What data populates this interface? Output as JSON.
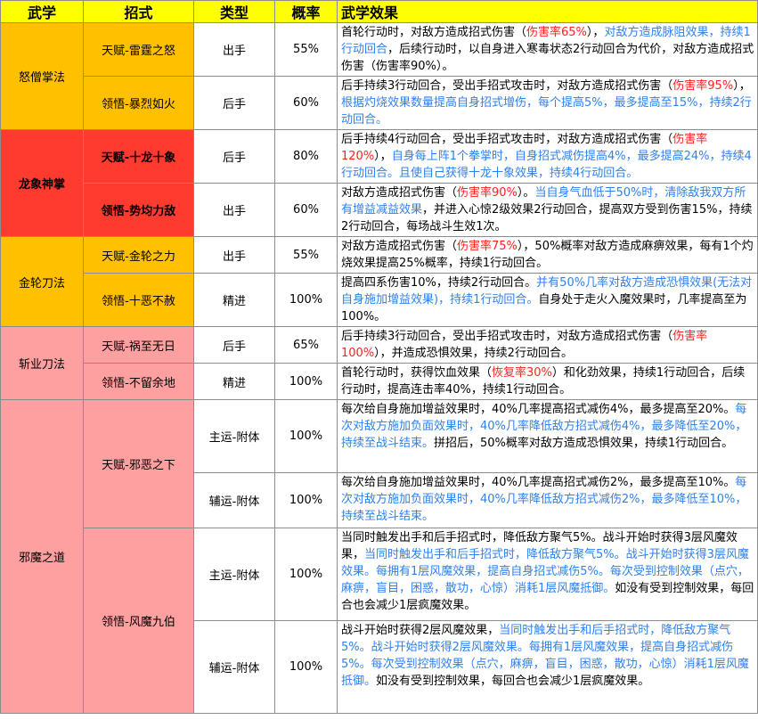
{
  "headers": [
    "武学",
    "招式",
    "类型",
    "概率",
    "武学效果"
  ],
  "groups": [
    {
      "name": "怒僧掌法",
      "rows": [
        {
          "move": "天赋-雷霆之怒",
          "type": "出手",
          "prob": "55%",
          "effect": [
            {
              "t": "首轮行动时，对敌方造成招式伤害（",
              "c": ""
            },
            {
              "t": "伤害率65%",
              "c": "r"
            },
            {
              "t": "），",
              "c": ""
            },
            {
              "t": "对敌方造成脉阻效果，持续1行动回合",
              "c": "b"
            },
            {
              "t": "，后续行动时，以自身进入寒毒状态2行动回合为代价，对敌方造成招式伤害（伤害率90%）。",
              "c": ""
            }
          ]
        },
        {
          "move": "领悟-暴烈如火",
          "type": "后手",
          "prob": "60%",
          "effect": [
            {
              "t": "后手持续3行动回合，受出手招式攻击时，对敌方造成招式伤害（",
              "c": ""
            },
            {
              "t": "伤害率95%",
              "c": "r"
            },
            {
              "t": "），",
              "c": ""
            },
            {
              "t": "根据灼烧效果数量提高自身招式增伤，每个提高5%，最多提高至15%，持续2行动回合。",
              "c": "b"
            }
          ]
        }
      ]
    },
    {
      "name": "龙象神掌",
      "rows": [
        {
          "move": "天赋-十龙十象",
          "type": "后手",
          "prob": "80%",
          "effect": [
            {
              "t": "后手持续4行动回合，受出手招式攻击时，对敌方造成招式伤害（",
              "c": ""
            },
            {
              "t": "伤害率120%",
              "c": "r"
            },
            {
              "t": "），",
              "c": ""
            },
            {
              "t": "自身每上阵1个拳掌时，自身招式减伤提高4%，最多提高24%，持续4行动回合。且使自己获得十龙十象效果，持续4行动回合。",
              "c": "b"
            }
          ]
        },
        {
          "move": "领悟-势均力敌",
          "type": "出手",
          "prob": "60%",
          "effect": [
            {
              "t": "对敌方造成招式伤害（",
              "c": ""
            },
            {
              "t": "伤害率90%",
              "c": "r"
            },
            {
              "t": "）。",
              "c": ""
            },
            {
              "t": "当自身气血低于50%时，清除敌我双方所有增益减益效果",
              "c": "b"
            },
            {
              "t": "，并进入心惊2级效果2行动回合，提高双方受到伤害15%，持续2行动回合，每场战斗生效1次。",
              "c": ""
            }
          ]
        }
      ]
    },
    {
      "name": "金轮刀法",
      "rows": [
        {
          "move": "天赋-金轮之力",
          "type": "出手",
          "prob": "55%",
          "effect": [
            {
              "t": "对敌方造成招式伤害（",
              "c": ""
            },
            {
              "t": "伤害率75%",
              "c": "r"
            },
            {
              "t": "），50%概率对敌方造成麻痹效果，每有1个灼烧效果提高25%概率，持续1行动回合。",
              "c": ""
            }
          ]
        },
        {
          "move": "领悟-十恶不赦",
          "type": "精进",
          "prob": "100%",
          "effect": [
            {
              "t": "提高四系伤害10%，持续2行动回合。",
              "c": ""
            },
            {
              "t": "并有50%几率对敌方造成恐惧效果(无法对自身施加增益效果)，持续1行动回合。",
              "c": "b"
            },
            {
              "t": "自身处于走火入魔效果时，几率提高至为100%。",
              "c": ""
            }
          ]
        }
      ]
    },
    {
      "name": "斩业刀法",
      "rows": [
        {
          "move": "天赋-祸至无日",
          "type": "后手",
          "prob": "65%",
          "effect": [
            {
              "t": "后手持续3行动回合，受出手招式攻击时，对敌方造成招式伤害（",
              "c": ""
            },
            {
              "t": "伤害率100%",
              "c": "r"
            },
            {
              "t": "），并造成恐惧效果，持续2行动回合。",
              "c": ""
            }
          ]
        },
        {
          "move": "领悟-不留余地",
          "type": "精进",
          "prob": "100%",
          "effect": [
            {
              "t": "首轮行动时，获得饮血效果（",
              "c": ""
            },
            {
              "t": "恢复率30%",
              "c": "r"
            },
            {
              "t": "）和化劲效果，持续1行动回合，后续行动时，提高连击率40%，持续1行动回合。",
              "c": ""
            }
          ]
        }
      ]
    },
    {
      "name": "邪魔之道",
      "moves": [
        {
          "move": "天赋-邪恶之下",
          "rows": [
            {
              "type": "主运-附体",
              "prob": "100%",
              "effect": [
                {
                  "t": "每次给自身施加增益效果时，40%几率提高招式减伤4%，最多提高至20%。",
                  "c": ""
                },
                {
                  "t": "每次对敌方施加负面效果时，40%几率降低敌方招式减伤4%，最多降低至20%，持续至战斗结束。",
                  "c": "b"
                },
                {
                  "t": "拼招后，50%概率对敌方造成恐惧效果，持续1行动回合。",
                  "c": ""
                }
              ]
            },
            {
              "type": "辅运-附体",
              "prob": "100%",
              "effect": [
                {
                  "t": "每次给自身施加增益效果时，40%几率提高招式减伤2%，最多提高至10%。",
                  "c": ""
                },
                {
                  "t": "每次对敌方施加负面效果时，40%几率降低敌方招式减伤2%，最多降低至10%，持续至战斗结束。",
                  "c": "b"
                }
              ]
            }
          ]
        },
        {
          "move": "领悟-风魔九伯",
          "rows": [
            {
              "type": "主运-附体",
              "prob": "100%",
              "effect": [
                {
                  "t": "当同时触发出手和后手招式时，降低敌方聚气5%。战斗开始时获得3层风魔效果，",
                  "c": ""
                },
                {
                  "t": "当同时触发出手和后手招式时，降低敌方聚气5%。战斗开始时获得3层风魔效果。每拥有1层风魔效果，提高自身招式减伤5%。每次受到控制效果（点穴，麻痹，盲目，困惑，散功，心惊）消耗1层风魔抵御。",
                  "c": "b"
                },
                {
                  "t": "如没有受到控制效果，每回合也会减少1层疯魔效果。",
                  "c": ""
                }
              ]
            },
            {
              "type": "辅运-附体",
              "prob": "100%",
              "effect": [
                {
                  "t": "战斗开始时获得2层风魔效果，",
                  "c": ""
                },
                {
                  "t": "当同时触发出手和后手招式时，降低敌方聚气5%。战斗开始时获得2层风魔效果。每拥有1层风魔效果，提高自身招式减伤5%。每次受到控制效果（点穴，麻痹，盲目，困惑，散功，心惊）消耗1层风魔抵御。",
                  "c": "b"
                },
                {
                  "t": "如没有受到控制效果，每回合也会减少1层疯魔效果。",
                  "c": ""
                }
              ]
            }
          ]
        }
      ]
    }
  ]
}
